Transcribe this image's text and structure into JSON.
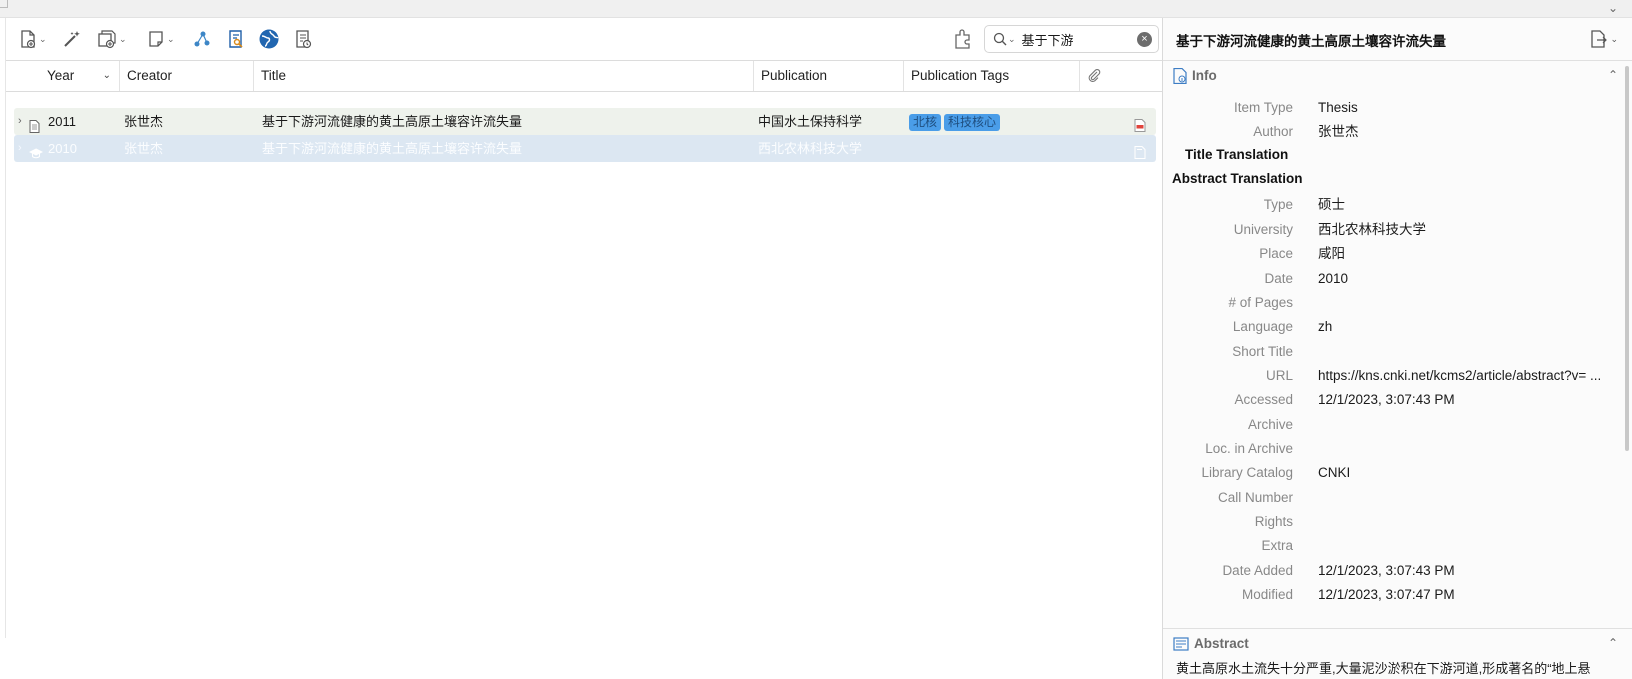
{
  "toolbar": {
    "buttons": [
      "new-item",
      "add-by-identifier",
      "new-attachment",
      "new-note",
      "graph",
      "find-pdf",
      "web",
      "log"
    ],
    "search": {
      "value": "基于下游",
      "placeholder": ""
    }
  },
  "columns": {
    "year": "Year",
    "creator": "Creator",
    "title": "Title",
    "publication": "Publication",
    "publication_tags": "Publication Tags"
  },
  "items": [
    {
      "year": "2011",
      "creator": "张世杰",
      "title": "基于下游河流健康的黄土高原土壤容许流失量",
      "publication": "中国水土保持科学",
      "tags": [
        "北核",
        "科技核心"
      ]
    },
    {
      "year": "2010",
      "creator": "张世杰",
      "title": "基于下游河流健康的黄土高原土壤容许流失量",
      "publication": "西北农林科技大学",
      "tags": []
    }
  ],
  "detail": {
    "title": "基于下游河流健康的黄土高原土壤容许流失量",
    "info_label": "Info",
    "fields": [
      {
        "k": "Item Type",
        "v": "Thesis"
      },
      {
        "k": "Author",
        "v": "张世杰"
      },
      {
        "k": "Title Translation",
        "v": ""
      },
      {
        "k": "Abstract Translation",
        "v": ""
      },
      {
        "k": "Type",
        "v": "硕士"
      },
      {
        "k": "University",
        "v": "西北农林科技大学"
      },
      {
        "k": "Place",
        "v": "咸阳"
      },
      {
        "k": "Date",
        "v": "2010"
      },
      {
        "k": "# of Pages",
        "v": ""
      },
      {
        "k": "Language",
        "v": "zh"
      },
      {
        "k": "Short Title",
        "v": ""
      },
      {
        "k": "URL",
        "v": "https://kns.cnki.net/kcms2/article/abstract?v= ..."
      },
      {
        "k": "Accessed",
        "v": "12/1/2023, 3:07:43 PM"
      },
      {
        "k": "Archive",
        "v": ""
      },
      {
        "k": "Loc. in Archive",
        "v": ""
      },
      {
        "k": "Library Catalog",
        "v": "CNKI"
      },
      {
        "k": "Call Number",
        "v": ""
      },
      {
        "k": "Rights",
        "v": ""
      },
      {
        "k": "Extra",
        "v": ""
      },
      {
        "k": "Date Added",
        "v": "12/1/2023, 3:07:43 PM"
      },
      {
        "k": "Modified",
        "v": "12/1/2023, 3:07:47 PM"
      }
    ],
    "abstract_label": "Abstract",
    "abstract_text": "黄土高原水土流失十分严重,大量泥沙淤积在下游河道,形成著名的“地上悬"
  },
  "colors": {
    "tag_bg": "#4a9de8",
    "selected_row": "#dce7f2",
    "row1": "#eef2ec"
  }
}
